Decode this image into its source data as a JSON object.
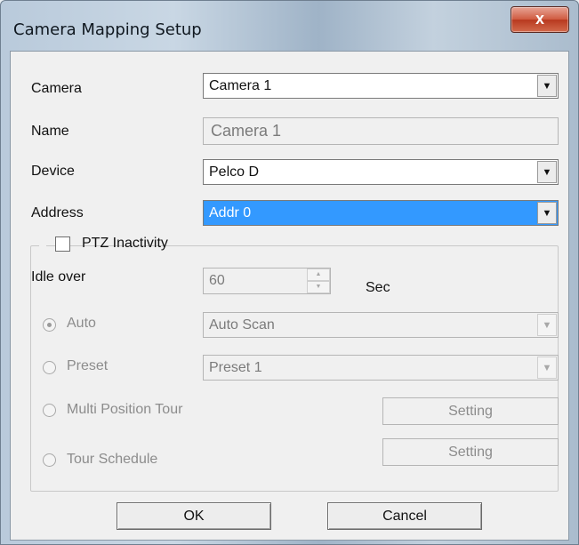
{
  "window": {
    "title": "Camera Mapping Setup",
    "close_glyph": "x"
  },
  "fields": {
    "camera": {
      "label": "Camera",
      "value": "Camera 1"
    },
    "name": {
      "label": "Name",
      "value": "Camera 1"
    },
    "device": {
      "label": "Device",
      "value": "Pelco D"
    },
    "address": {
      "label": "Address",
      "value": "Addr 0"
    }
  },
  "ptz": {
    "group_label": "PTZ Inactivity",
    "checked": false,
    "idle_label": "Idle over",
    "idle_value": "60",
    "idle_unit": "Sec",
    "options": {
      "auto": {
        "label": "Auto",
        "selected": true,
        "combo_value": "Auto Scan"
      },
      "preset": {
        "label": "Preset",
        "selected": false,
        "combo_value": "Preset 1"
      },
      "multi_position_tour": {
        "label": "Multi Position Tour",
        "selected": false,
        "button": "Setting"
      },
      "tour_schedule": {
        "label": "Tour Schedule",
        "selected": false,
        "button": "Setting"
      }
    }
  },
  "buttons": {
    "ok": "OK",
    "cancel": "Cancel"
  },
  "icons": {
    "dropdown_arrow": "▼",
    "spin_up": "▲",
    "spin_down": "▼"
  },
  "colors": {
    "selection": "#3399ff",
    "close_button": "#c8462a"
  }
}
